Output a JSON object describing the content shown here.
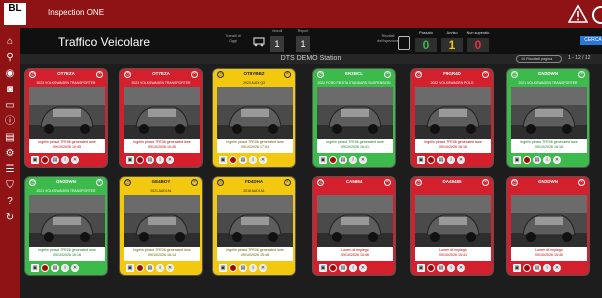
{
  "app": {
    "logo": "BL",
    "logo_sub": "",
    "title": "Inspection ONE"
  },
  "header": {
    "page_title": "Traffico Veicolare",
    "transit_label_1": "Transiti di",
    "transit_label_2": "Oggi",
    "vehicles_label": "Veicoli",
    "vehicles_value": "1",
    "reports_label": "Report",
    "reports_value": "1",
    "results_label_1": "Risultati",
    "results_label_2": "dell'ispezione",
    "pass_label": "Passato",
    "pass_value": "0",
    "warn_label": "Avviso",
    "warn_value": "1",
    "fail_label": "Non superato",
    "fail_value": "0",
    "search_button": "CERCA"
  },
  "station": {
    "title": "DTS DEMO Station",
    "page_select": "10 Risultati pagina",
    "pager": "1 - 12 / 12"
  },
  "colors": {
    "red": "#d41f2c",
    "green": "#3cba4c",
    "yellow": "#f2c90e",
    "brand": "#8f1214"
  },
  "cards": [
    {
      "plate": "OT7EZA",
      "status": "red",
      "model": "2023 VOLKSWAGEN TRANSPORTER",
      "msg": "Ingelin pinsol 7FE06 generated lane",
      "date": "09/10/2026 10:45"
    },
    {
      "plate": "OT7EZA",
      "status": "red",
      "model": "2023 VOLKSWAGEN TRANSPORTER",
      "msg": "Ingelin pinsol 7FE06 generated lane",
      "date": "09/10/2026 10:45"
    },
    {
      "plate": "OT8YBBZ",
      "status": "yellow",
      "model": "2023 AUDI Q3",
      "msg": "Ingelin pinsol 7FE06 generated lane",
      "date": "09/10/2026 17:04"
    },
    {
      "plate": "EN2BCL",
      "status": "green",
      "model": "2022 FORD FIESTA STANDARD SUSPENSION",
      "msg": "Ingelin pinsol 7FE06 generated lane",
      "date": "09/10/2026 16:41"
    },
    {
      "plate": "F9GR4D",
      "status": "red",
      "model": "2022 VOLKSWAGEN POLO",
      "msg": "Ingelin pinsol 7FE06 generated lane",
      "date": "09/10/2026 16:16"
    },
    {
      "plate": "GN2DWN",
      "status": "green",
      "model": "2021 VOLKSWAGEN TRANSPORTER",
      "msg": "Ingelin pinsol 7FE06 generated lane",
      "date": "09/10/2026 16:16"
    },
    {
      "plate": "GN2DWN",
      "status": "green",
      "model": "2021 VOLKSWAGEN TRANSPORTER",
      "msg": "Ingelin pinsol 7FE06 generated lane",
      "date": "09/10/2026 16:16"
    },
    {
      "plate": "GE4BOY",
      "status": "yellow",
      "model": "2021 AUDI A1",
      "msg": "Ingelin pinsol 7FE06 generated lane",
      "date": "09/10/2026 16:14"
    },
    {
      "plate": "FD4DHA",
      "status": "yellow",
      "model": "2016 AUDI A1",
      "msg": "Ingelin pinsol 7FE06 generated lane",
      "date": "09/10/2026 15:48"
    },
    {
      "plate": "CA5684",
      "status": "red",
      "model": "",
      "msg": "Lorem di impiego",
      "date": "09/10/2026 15:46"
    },
    {
      "plate": "DA49485",
      "status": "red",
      "model": "",
      "msg": "Lorem di impiego",
      "date": "09/10/2026 15:41"
    },
    {
      "plate": "GN2DWN",
      "status": "red",
      "model": "",
      "msg": "Lorem di impiego",
      "date": "09/10/2026 15:40"
    }
  ]
}
